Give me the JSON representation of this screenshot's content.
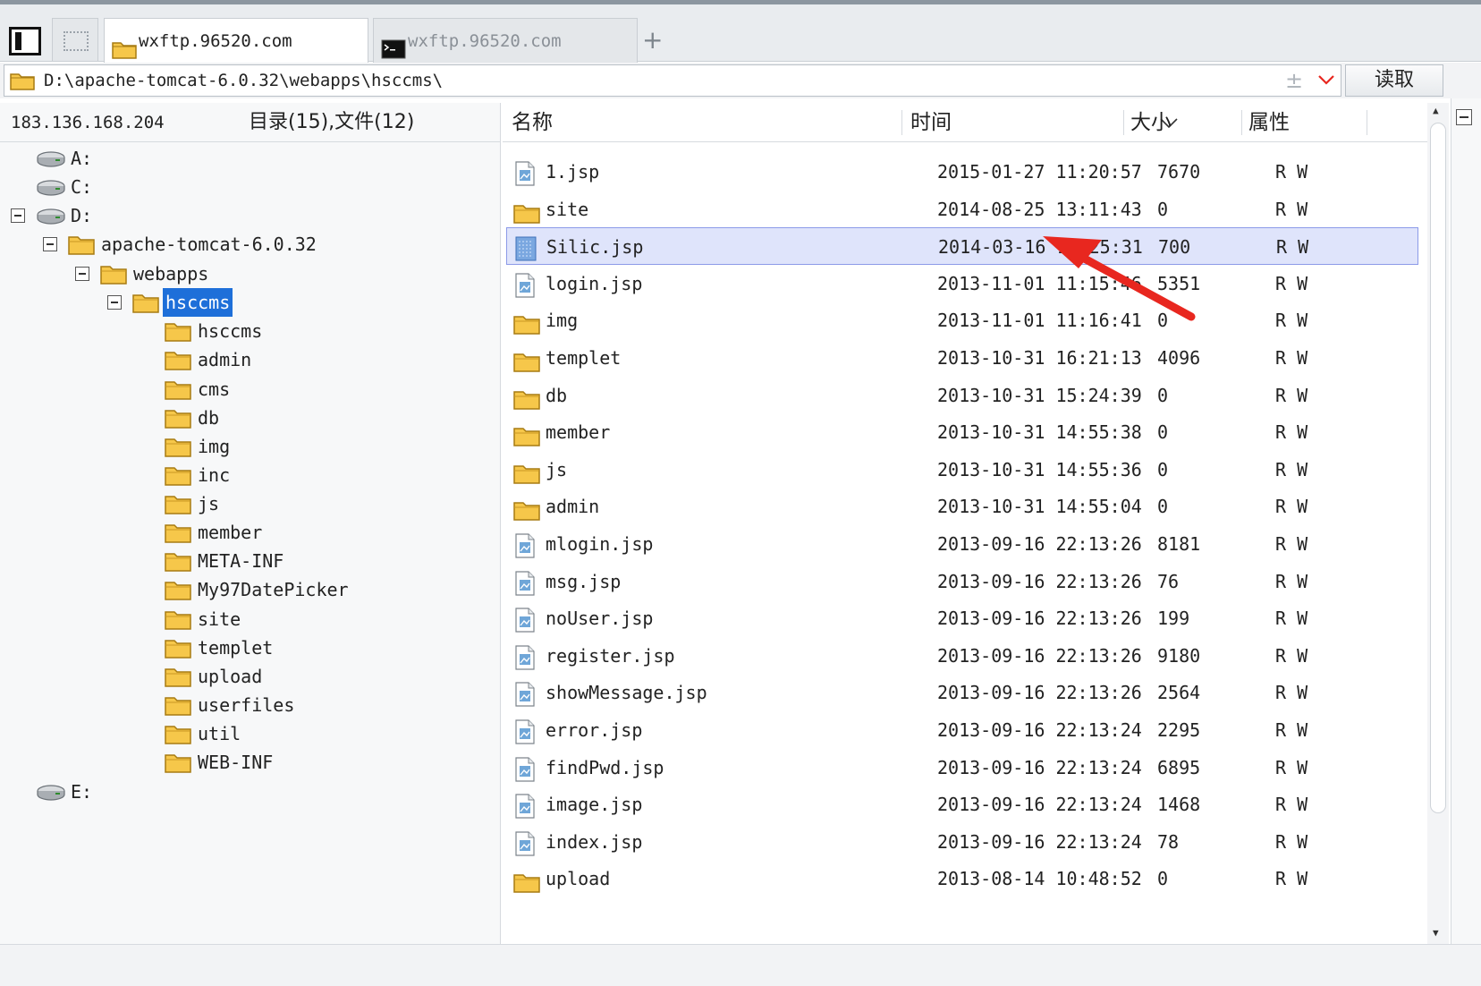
{
  "tabs": [
    {
      "label": "wxftp.96520.com",
      "icon": "folder-icon",
      "active": true
    },
    {
      "label": "wxftp.96520.com",
      "icon": "terminal-icon",
      "active": false
    }
  ],
  "add_tab_label": "+",
  "address": {
    "path": "D:\\apache-tomcat-6.0.32\\webapps\\hsccms\\",
    "read_label": "读取",
    "pin_glyph": "±"
  },
  "left": {
    "ip": "183.136.168.204",
    "summary": "目录(15),文件(12)",
    "tree": [
      {
        "label": "A:",
        "icon": "drive-icon"
      },
      {
        "label": "C:",
        "icon": "drive-icon"
      },
      {
        "label": "D:",
        "icon": "drive-icon",
        "expanded": true
      },
      {
        "label": "apache-tomcat-6.0.32",
        "icon": "folder-icon",
        "expanded": true
      },
      {
        "label": "webapps",
        "icon": "folder-icon",
        "expanded": true
      },
      {
        "label": "hsccms",
        "icon": "folder-icon",
        "expanded": true,
        "selected": true
      },
      {
        "label": "hsccms",
        "icon": "folder-icon"
      },
      {
        "label": "admin",
        "icon": "folder-icon"
      },
      {
        "label": "cms",
        "icon": "folder-icon"
      },
      {
        "label": "db",
        "icon": "folder-icon"
      },
      {
        "label": "img",
        "icon": "folder-icon"
      },
      {
        "label": "inc",
        "icon": "folder-icon"
      },
      {
        "label": "js",
        "icon": "folder-icon"
      },
      {
        "label": "member",
        "icon": "folder-icon"
      },
      {
        "label": "META-INF",
        "icon": "folder-icon"
      },
      {
        "label": "My97DatePicker",
        "icon": "folder-icon"
      },
      {
        "label": "site",
        "icon": "folder-icon"
      },
      {
        "label": "templet",
        "icon": "folder-icon"
      },
      {
        "label": "upload",
        "icon": "folder-icon"
      },
      {
        "label": "userfiles",
        "icon": "folder-icon"
      },
      {
        "label": "util",
        "icon": "folder-icon"
      },
      {
        "label": "WEB-INF",
        "icon": "folder-icon"
      },
      {
        "label": "E:",
        "icon": "drive-icon"
      }
    ]
  },
  "columns": {
    "name": "名称",
    "time": "时间",
    "size": "大小",
    "attr": "属性"
  },
  "files": [
    {
      "name": "1.jsp",
      "time": "2015-01-27 11:20:57",
      "size": "7670",
      "attr": "R W",
      "type": "file"
    },
    {
      "name": "site",
      "time": "2014-08-25 13:11:43",
      "size": "0",
      "attr": "R W",
      "type": "folder"
    },
    {
      "name": "Silic.jsp",
      "time": "2014-03-16 19:25:31",
      "size": "700",
      "attr": "R W",
      "type": "file",
      "selected": true
    },
    {
      "name": "login.jsp",
      "time": "2013-11-01 11:15:46",
      "size": "5351",
      "attr": "R W",
      "type": "file"
    },
    {
      "name": "img",
      "time": "2013-11-01 11:16:41",
      "size": "0",
      "attr": "R W",
      "type": "folder"
    },
    {
      "name": "templet",
      "time": "2013-10-31 16:21:13",
      "size": "4096",
      "attr": "R W",
      "type": "folder"
    },
    {
      "name": "db",
      "time": "2013-10-31 15:24:39",
      "size": "0",
      "attr": "R W",
      "type": "folder"
    },
    {
      "name": "member",
      "time": "2013-10-31 14:55:38",
      "size": "0",
      "attr": "R W",
      "type": "folder"
    },
    {
      "name": "js",
      "time": "2013-10-31 14:55:36",
      "size": "0",
      "attr": "R W",
      "type": "folder"
    },
    {
      "name": "admin",
      "time": "2013-10-31 14:55:04",
      "size": "0",
      "attr": "R W",
      "type": "folder"
    },
    {
      "name": "mlogin.jsp",
      "time": "2013-09-16 22:13:26",
      "size": "8181",
      "attr": "R W",
      "type": "file"
    },
    {
      "name": "msg.jsp",
      "time": "2013-09-16 22:13:26",
      "size": "76",
      "attr": "R W",
      "type": "file"
    },
    {
      "name": "noUser.jsp",
      "time": "2013-09-16 22:13:26",
      "size": "199",
      "attr": "R W",
      "type": "file"
    },
    {
      "name": "register.jsp",
      "time": "2013-09-16 22:13:26",
      "size": "9180",
      "attr": "R W",
      "type": "file"
    },
    {
      "name": "showMessage.jsp",
      "time": "2013-09-16 22:13:26",
      "size": "2564",
      "attr": "R W",
      "type": "file"
    },
    {
      "name": "error.jsp",
      "time": "2013-09-16 22:13:24",
      "size": "2295",
      "attr": "R W",
      "type": "file"
    },
    {
      "name": "findPwd.jsp",
      "time": "2013-09-16 22:13:24",
      "size": "6895",
      "attr": "R W",
      "type": "file"
    },
    {
      "name": "image.jsp",
      "time": "2013-09-16 22:13:24",
      "size": "1468",
      "attr": "R W",
      "type": "file"
    },
    {
      "name": "index.jsp",
      "time": "2013-09-16 22:13:24",
      "size": "78",
      "attr": "R W",
      "type": "file"
    },
    {
      "name": "upload",
      "time": "2013-08-14 10:48:52",
      "size": "0",
      "attr": "R W",
      "type": "folder"
    }
  ],
  "colors": {
    "selection_blue": "#1e6fd9",
    "row_highlight": "#dfe4fb",
    "folder_yellow": "#f6c74a",
    "annotation_red": "#e8271f"
  }
}
